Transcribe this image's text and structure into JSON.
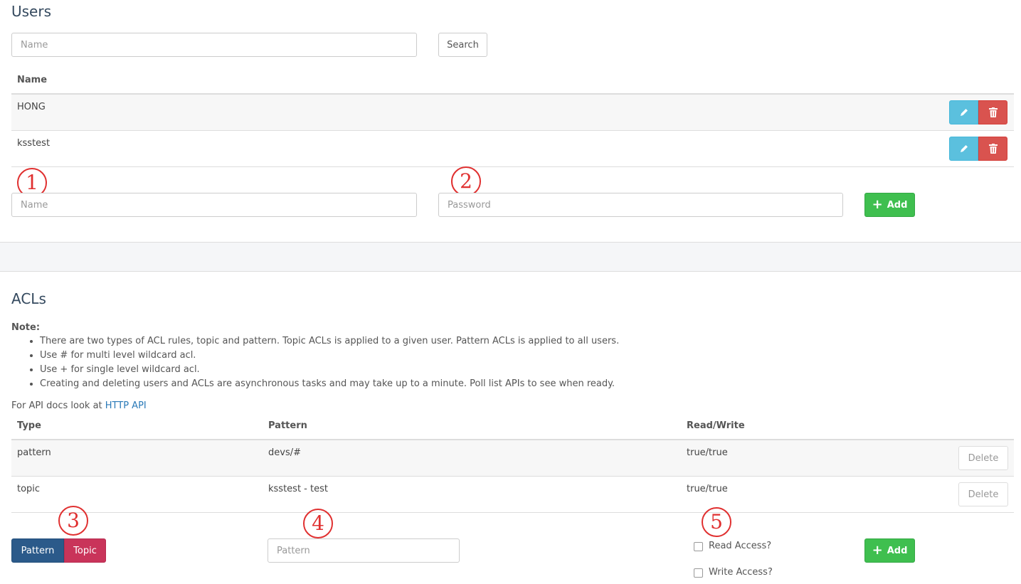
{
  "users": {
    "title": "Users",
    "search_placeholder": "Name",
    "search_button": "Search",
    "column_name": "Name",
    "rows": [
      {
        "name": "HONG"
      },
      {
        "name": "ksstest"
      }
    ],
    "add_name_placeholder": "Name",
    "add_password_placeholder": "Password",
    "add_button": "Add"
  },
  "acls": {
    "title": "ACLs",
    "note_label": "Note:",
    "notes": [
      "There are two types of ACL rules, topic and pattern. Topic ACLs is applied to a given user. Pattern ACLs is applied to all users.",
      "Use # for multi level wildcard acl.",
      "Use + for single level wildcard acl.",
      "Creating and deleting users and ACLs are asynchronous tasks and may take up to a minute. Poll list APIs to see when ready."
    ],
    "api_prefix": "For API docs look at ",
    "api_link": "HTTP API",
    "columns": {
      "type": "Type",
      "pattern": "Pattern",
      "rw": "Read/Write"
    },
    "rows": [
      {
        "type": "pattern",
        "pattern": "devs/#",
        "rw": "true/true",
        "delete": "Delete"
      },
      {
        "type": "topic",
        "pattern": "ksstest - test",
        "rw": "true/true",
        "delete": "Delete"
      }
    ],
    "toggle_pattern": "Pattern",
    "toggle_topic": "Topic",
    "pattern_placeholder": "Pattern",
    "read_access": "Read Access?",
    "write_access": "Write Access?",
    "add_button": "Add"
  },
  "annotations": {
    "m1": "1",
    "m2": "2",
    "m3": "3",
    "m4": "4",
    "m5": "5"
  },
  "colors": {
    "info": "#5bc0de",
    "danger": "#d9534f",
    "success": "#3fbf4f",
    "pattern_toggle": "#2b5a8a",
    "topic_toggle": "#c9345a",
    "marker": "#e03030"
  }
}
